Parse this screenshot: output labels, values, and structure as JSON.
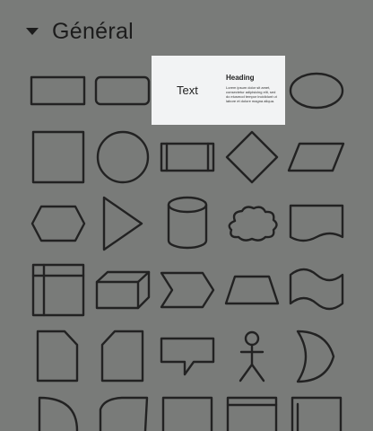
{
  "section": {
    "title": "Général"
  },
  "icons": {
    "collapse": "caret-down-icon"
  },
  "preview": {
    "text_label": "Text",
    "heading": "Heading",
    "body": "Lorem ipsum dolor sit amet, consectetur adipisicing elit, sed do eiusmod tempor incididunt ut labore et dolore magna aliqua."
  },
  "colors": {
    "background": "#797b79",
    "stroke": "#222222",
    "card": "#f2f3f4"
  }
}
